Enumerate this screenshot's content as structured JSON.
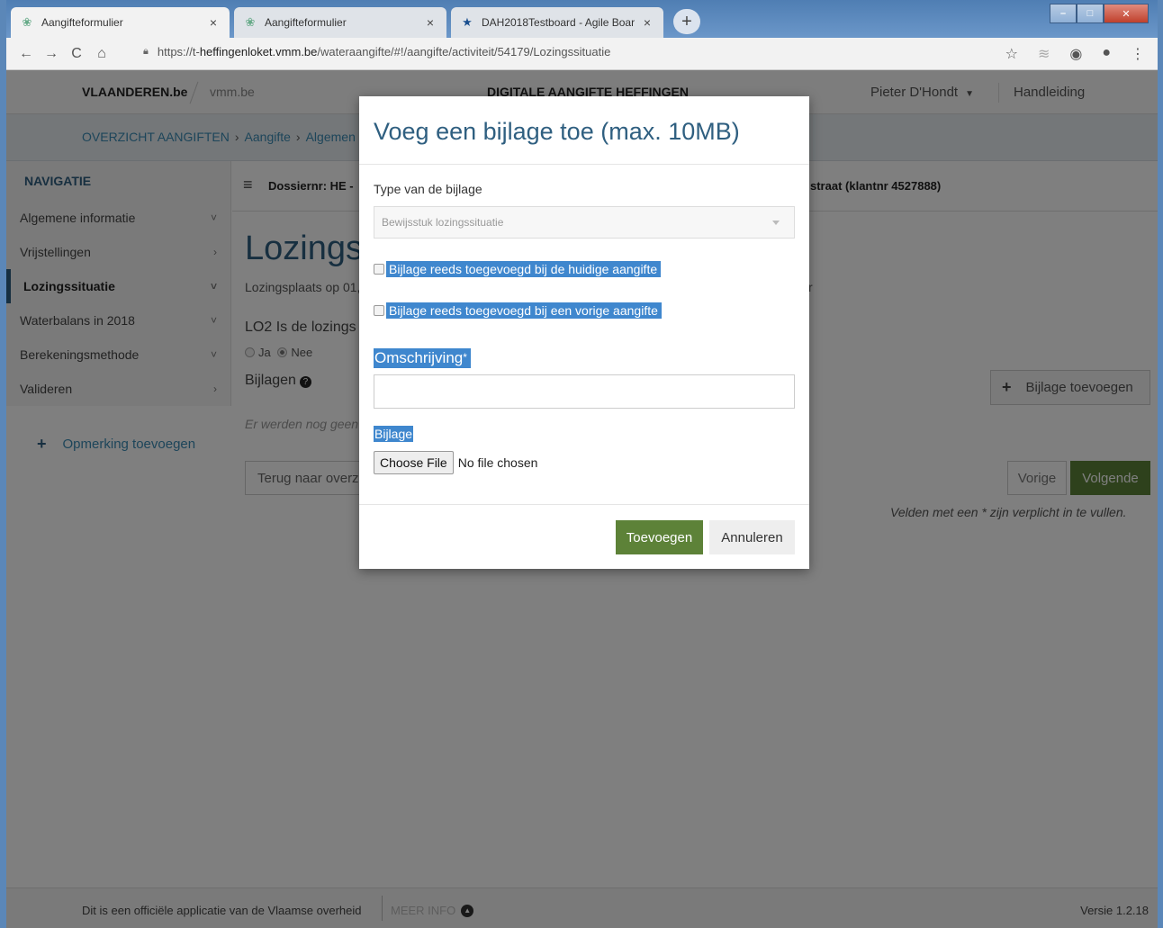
{
  "browser": {
    "tabs": [
      {
        "label": "Aangifteformulier",
        "icon": "vmm-favicon"
      },
      {
        "label": "Aangifteformulier",
        "icon": "vmm-favicon"
      },
      {
        "label": "DAH2018Testboard - Agile Boar",
        "icon": "jira-favicon"
      }
    ],
    "url_prefix": "https://t-",
    "url_domain": "heffingenloket.vmm.be",
    "url_path": "/wateraangifte/#!/aangifte/activiteit/54179/Lozingssituatie"
  },
  "header": {
    "brand": "VLAANDEREN.be",
    "brand_sub": "vmm.be",
    "app_title": "DIGITALE AANGIFTE HEFFINGEN",
    "user": "Pieter D'Hondt",
    "manual": "Handleiding"
  },
  "breadcrumb": {
    "items": [
      "OVERZICHT AANGIFTEN",
      "Aangifte",
      "Algemen"
    ]
  },
  "sidebar": {
    "heading": "NAVIGATIE",
    "items": [
      {
        "label": "Algemene informatie",
        "chevron": "˅"
      },
      {
        "label": "Vrijstellingen",
        "chevron": "›"
      },
      {
        "label": "Lozingssituatie",
        "chevron": "˅"
      },
      {
        "label": "Waterbalans in 2018",
        "chevron": "˅"
      },
      {
        "label": "Berekeningsmethode",
        "chevron": "˅"
      },
      {
        "label": "Valideren",
        "chevron": "›"
      }
    ],
    "add_remark": "Opmerking toevoegen"
  },
  "main": {
    "dossier": "Dossiernr: HE -",
    "client": "straat (klantnr 4527888)",
    "title": "Lozings",
    "line1": "Lozingsplaats op 01,",
    "line1_right": "r",
    "question": "LO2 Is de lozings",
    "radio_yes": "Ja",
    "radio_no": "Nee",
    "attachments": "Bijlagen",
    "no_attachments": "Er werden nog geen",
    "back_button": "Terug naar overz",
    "add_attachment_button": "Bijlage toevoegen",
    "prev_button": "Vorige",
    "next_button": "Volgende",
    "required_note": "Velden met een * zijn verplicht in te vullen."
  },
  "footer": {
    "official": "Dit is een officiële applicatie van de Vlaamse overheid",
    "more_info": "MEER INFO",
    "version": "Versie 1.2.18"
  },
  "modal": {
    "title": "Voeg een bijlage toe (max. 10MB)",
    "type_label": "Type van de bijlage",
    "type_value": "Bewijsstuk lozingssituatie",
    "checkbox_current": "Bijlage reeds toegevoegd bij de huidige aangifte",
    "checkbox_previous": "Bijlage reeds toegevoegd bij een vorige aangifte",
    "description_label": "Omschrijving",
    "required_mark": "*",
    "description_value": "",
    "file_label": "Bijlage",
    "choose_file": "Choose File",
    "no_file": "No file chosen",
    "add_button": "Toevoegen",
    "cancel_button": "Annuleren"
  }
}
